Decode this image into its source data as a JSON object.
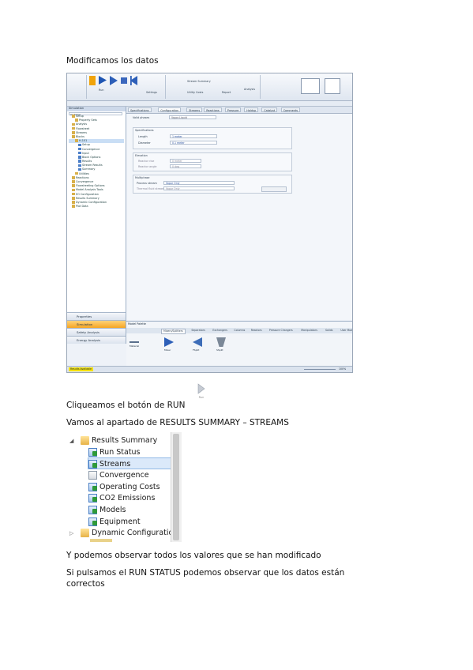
{
  "doc": {
    "heading": "Modificamos los datos",
    "run_instruction": "Cliqueamos el botón de RUN",
    "results_instruction": "Vamos al apartado de RESULTS SUMMARY – STREAMS",
    "observe_text": "Y podemos observar todos los valores que se han modificado",
    "run_status_text": "Si pulsamos el RUN STATUS podemos observar que los datos están correctos",
    "run_icon_label": "Run"
  },
  "app": {
    "ribbon": {
      "run_label": "Run",
      "settings_label": "Settings",
      "utility_costs_label": "Utility Costs",
      "analysis_label": "Analysis",
      "report_label": "Report",
      "stream_summary_label": "Stream Summary"
    },
    "nav_title": "Simulation",
    "nav_filter": "All Items",
    "tree": [
      "Setup",
      "Property Sets",
      "Analysis",
      "Flowsheet",
      "Streams",
      "Blocks",
      "H-101",
      "Setup",
      "Convergence",
      "Input",
      "Block Options",
      "Results",
      "Stream Results",
      "Summary",
      "Utilities",
      "Reactions",
      "Convergence",
      "Flowsheeting Options",
      "Model Analysis Tools",
      "EO Configuration",
      "Results Summary",
      "Dynamic Configuration",
      "Plot Data"
    ],
    "nav_buttons": [
      "Properties",
      "Simulation",
      "Safety Analysis",
      "Energy Analysis"
    ],
    "tabs": [
      "Specifications",
      "Configuration",
      "Streams",
      "Reactions",
      "Pressure",
      "Holdup",
      "Catalyst",
      "Comments"
    ],
    "form": {
      "valid_phases_label": "Valid phases",
      "valid_phases_value": "Vapor-Liquid",
      "group1_title": "Specifications",
      "length_label": "Length",
      "length_value": "1 meter",
      "diameter_label": "Diameter",
      "diameter_value": "0.1 meter",
      "group2_title": "Elevation",
      "rise_label": "Reactor rise",
      "rise_value": "0 meter",
      "angle_label": "Reactor angle",
      "angle_value": "0 deg",
      "group3_title": "Multiphase",
      "process_stream_label": "Process stream",
      "process_stream_value": "Vapor Only",
      "hold_label": "Thermal fluid stream",
      "hold_value": "Vapor Only"
    },
    "bottom_title": "Model Palette",
    "palette_tabs": [
      "Mixers/Splitters",
      "Separators",
      "Exchangers",
      "Columns",
      "Reactors",
      "Pressure Changers",
      "Manipulators",
      "Solids",
      "User Models"
    ],
    "palette_models": [
      "Material",
      "Mixer",
      "FSplit",
      "SSplit"
    ],
    "status_left": "Results Available",
    "status_zoom": "100%"
  },
  "results_tree": {
    "header": "Results Summary",
    "items": [
      "Run Status",
      "Streams",
      "Convergence",
      "Operating Costs",
      "CO2 Emissions",
      "Models",
      "Equipment"
    ],
    "footer_item": "Dynamic Configuration"
  },
  "colors": {
    "accent": "#2d5fb8",
    "active_nav": "#f5a623",
    "selection": "#dbe9fa"
  }
}
